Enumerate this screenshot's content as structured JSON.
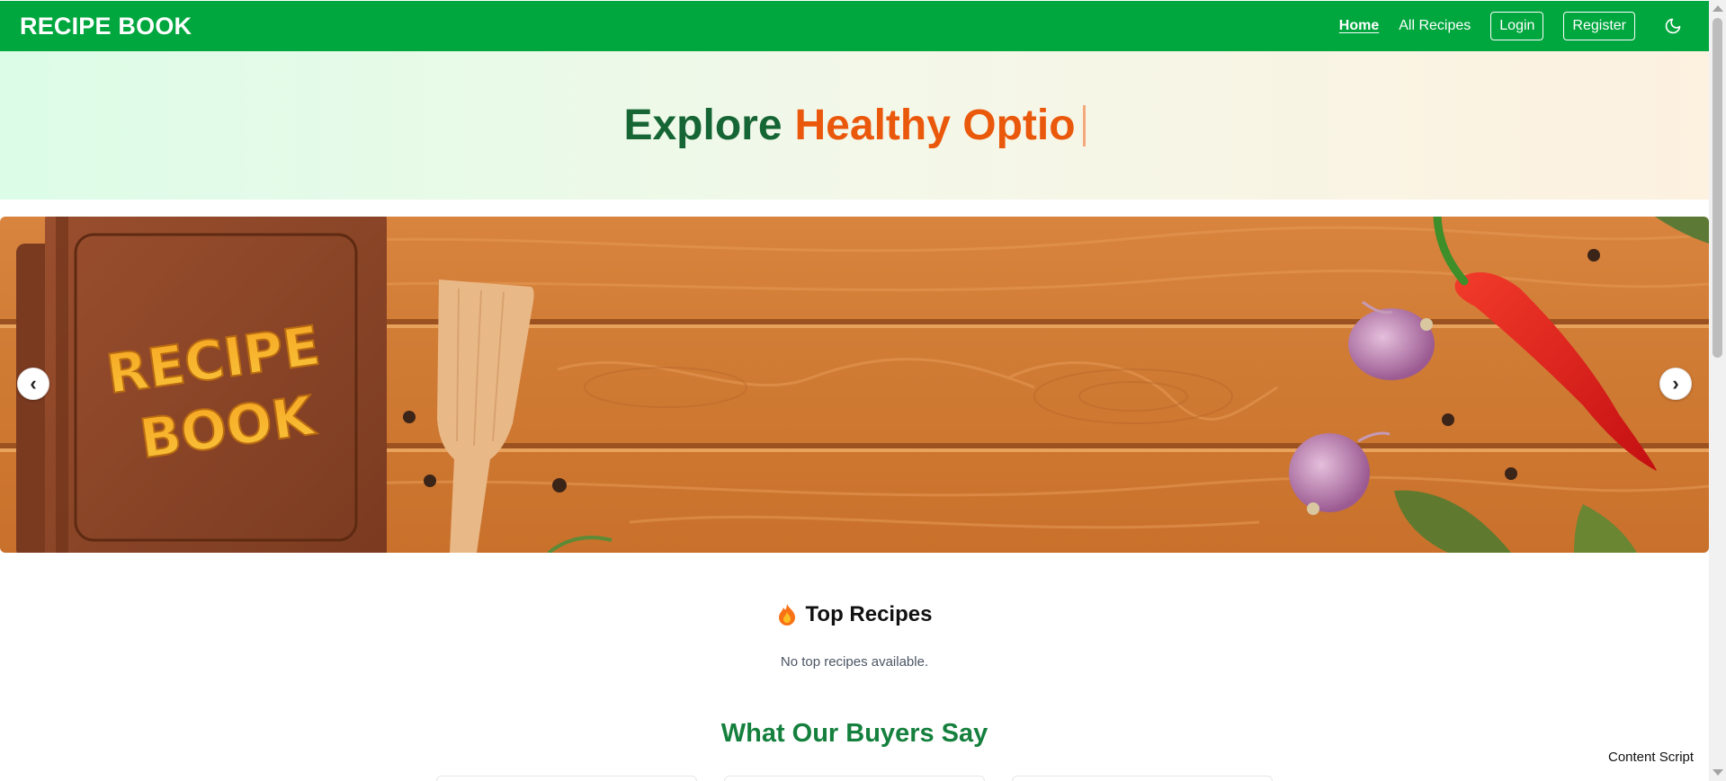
{
  "navbar": {
    "brand": "RECIPE BOOK",
    "links": [
      "Home",
      "All Recipes"
    ],
    "login": "Login",
    "register": "Register",
    "theme_icon": "moon-icon",
    "color": "#00a63e"
  },
  "hero": {
    "prefix": "Explore",
    "typed": "Healthy Optio"
  },
  "carousel": {
    "book_line1": "RECIPE",
    "book_line2": "BOOK",
    "prev": "‹",
    "next": "›"
  },
  "top_recipes": {
    "title": "Top Recipes",
    "icon": "fire-icon",
    "empty": "No top recipes available."
  },
  "testimonials": {
    "title": "What Our Buyers Say"
  },
  "overlay": {
    "label": "Content Script"
  }
}
